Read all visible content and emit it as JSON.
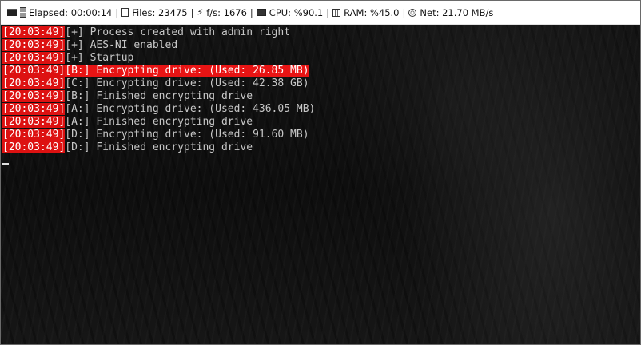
{
  "status_bar": {
    "elapsed": "Elapsed: 00:00:14",
    "files": "Files: 23475",
    "rate": "f/s: 1676",
    "cpu": "CPU: %90.1",
    "ram": "RAM: %45.0",
    "net": "Net: 21.70 MB/s",
    "separator": "|"
  },
  "console": {
    "lines": [
      {
        "timestamp": "[20:03:49]",
        "message": "[+] Process created with admin right"
      },
      {
        "timestamp": "[20:03:49]",
        "message": "[+] AES-NI enabled"
      },
      {
        "timestamp": "[20:03:49]",
        "message": "[+] Startup"
      },
      {
        "timestamp": "[20:03:49]",
        "message": "[B:] Encrypting drive: (Used: 26.85 MB)"
      },
      {
        "timestamp": "[20:03:49]",
        "message": "[C:] Encrypting drive: (Used: 42.38 GB)"
      },
      {
        "timestamp": "[20:03:49]",
        "message": "[B:] Finished encrypting drive"
      },
      {
        "timestamp": "[20:03:49]",
        "message": "[A:] Encrypting drive: (Used: 436.05 MB)"
      },
      {
        "timestamp": "[20:03:49]",
        "message": "[A:] Finished encrypting drive"
      },
      {
        "timestamp": "[20:03:49]",
        "message": "[D:] Encrypting drive: (Used: 91.60 MB)"
      },
      {
        "timestamp": "[20:03:49]",
        "message": "[D:] Finished encrypting drive"
      }
    ]
  },
  "colors": {
    "timestamp_bg": "#d11111",
    "highlight_bg": "#e81414",
    "text": "#c7c7c7"
  }
}
